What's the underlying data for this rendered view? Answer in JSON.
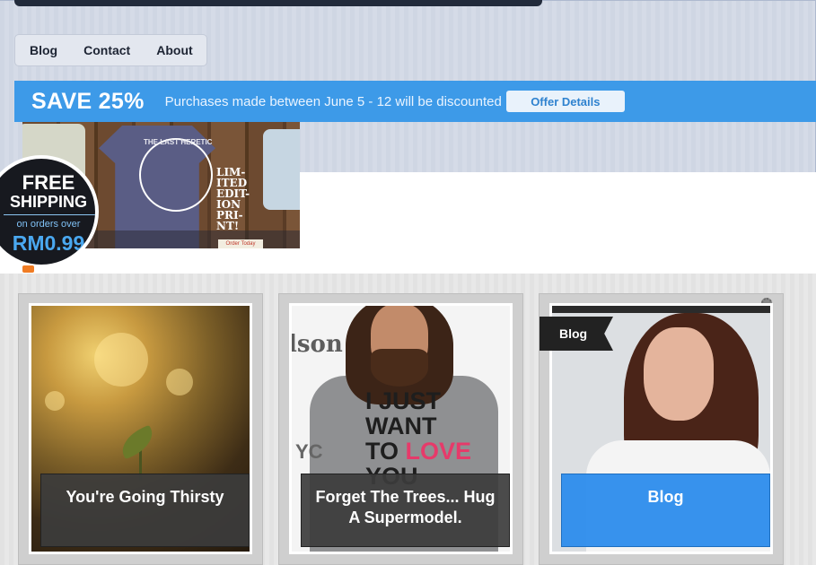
{
  "nav": {
    "items": [
      "Blog",
      "Contact",
      "About"
    ]
  },
  "promo": {
    "title": "SAVE 25%",
    "text": "Purchases made between June 5 - 12 will be discounted",
    "button": "Offer Details"
  },
  "banner": {
    "shirt_text": "THE LAST HERETIC",
    "limited_text": "LIM-\nITED\nEDIT-\nION\nPRI-\nNT!",
    "order_button": "Order Today"
  },
  "shipping_badge": {
    "line1": "FREE",
    "line2": "SHIPPING",
    "line3": "on orders over",
    "price": "RM0.99"
  },
  "cards": [
    {
      "caption": "You're Going Thirsty"
    },
    {
      "caption": "Forget The Trees... Hug A Supermodel.",
      "photo_bg_text": "lson",
      "tee_words": [
        "I JUST",
        "WANT",
        "TO",
        "LOVE",
        "YOU"
      ]
    },
    {
      "caption": "Blog",
      "tag": "Blog"
    }
  ],
  "colors": {
    "promo": "#3d9ae8",
    "accent_blue": "#2c8cec",
    "dark": "#222b3b"
  }
}
